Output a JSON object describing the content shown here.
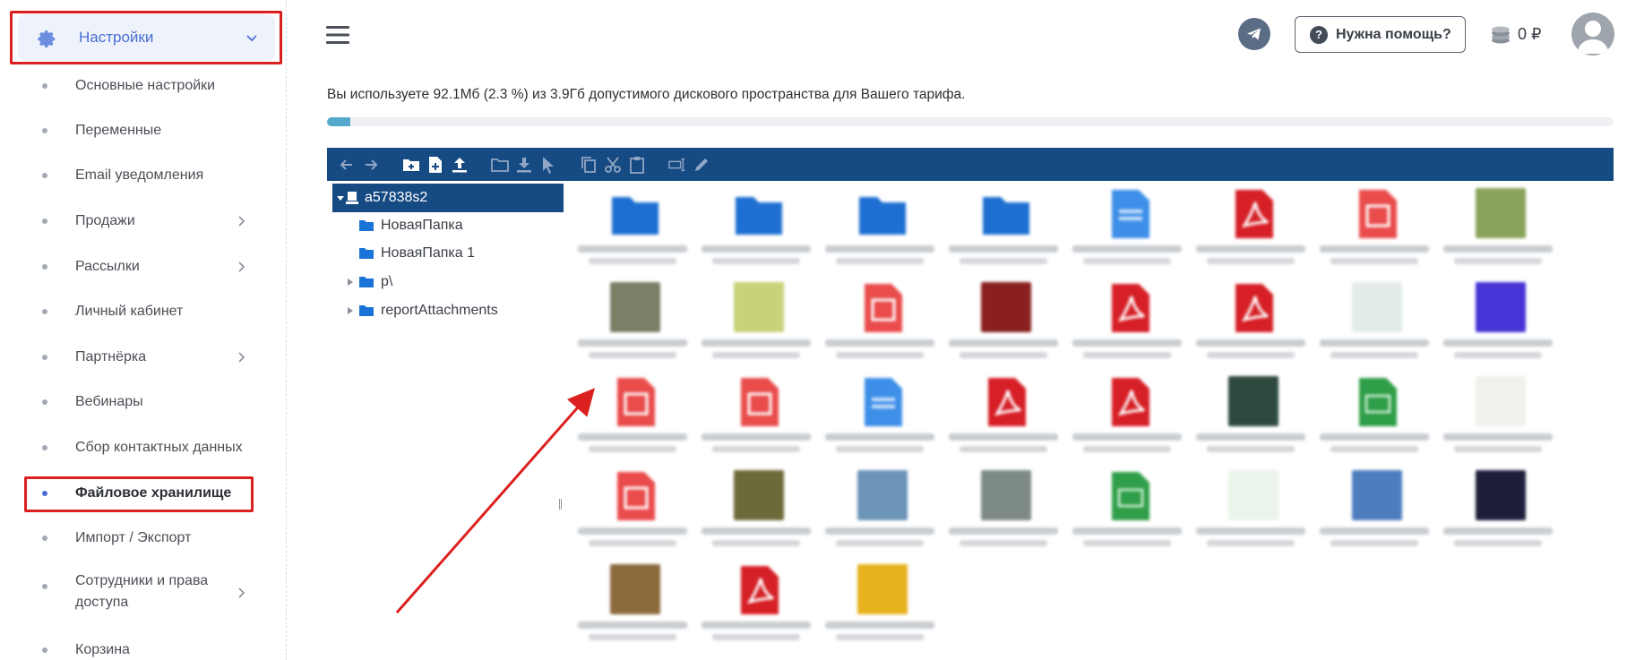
{
  "sidebar": {
    "header": {
      "label": "Настройки",
      "icon": "gear-icon"
    },
    "items": [
      {
        "label": "Основные настройки",
        "has_children": false
      },
      {
        "label": "Переменные",
        "has_children": false
      },
      {
        "label": "Email уведомления",
        "has_children": false
      },
      {
        "label": "Продажи",
        "has_children": true
      },
      {
        "label": "Рассылки",
        "has_children": true
      },
      {
        "label": "Личный кабинет",
        "has_children": false
      },
      {
        "label": "Партнёрка",
        "has_children": true
      },
      {
        "label": "Вебинары",
        "has_children": false
      },
      {
        "label": "Сбор контактных данных",
        "has_children": false
      },
      {
        "label": "Файловое хранилище",
        "has_children": false,
        "active": true
      },
      {
        "label": "Импорт / Экспорт",
        "has_children": false
      },
      {
        "label": "Сотрудники и права доступа",
        "has_children": true
      },
      {
        "label": "Корзина",
        "has_children": false
      }
    ]
  },
  "topbar": {
    "menu_icon": "hamburger-icon",
    "telegram_icon": "telegram-icon",
    "help_label": "Нужна помощь?",
    "balance": "0 ₽",
    "avatar_icon": "user-avatar-icon"
  },
  "storage": {
    "usage_text": "Вы используете 92.1Мб (2.3 %) из 3.9Гб допустимого дискового пространства для Вашего тарифа.",
    "usage_percent": 2.3,
    "bar_color": "#55aacc"
  },
  "toolbar": {
    "icons": [
      "back-icon",
      "forward-icon",
      "new-folder-icon",
      "new-file-icon",
      "upload-icon",
      "open-icon",
      "download-icon",
      "select-icon",
      "copy-icon",
      "cut-icon",
      "paste-icon",
      "rename-icon",
      "edit-icon"
    ],
    "color": "#164a82"
  },
  "tree": {
    "root": "a57838s2",
    "children": [
      {
        "label": "НоваяПапка",
        "expandable": false
      },
      {
        "label": "НоваяПапка 1",
        "expandable": false
      },
      {
        "label": "p\\",
        "expandable": true
      },
      {
        "label": "reportAttachments",
        "expandable": true
      }
    ]
  }
}
